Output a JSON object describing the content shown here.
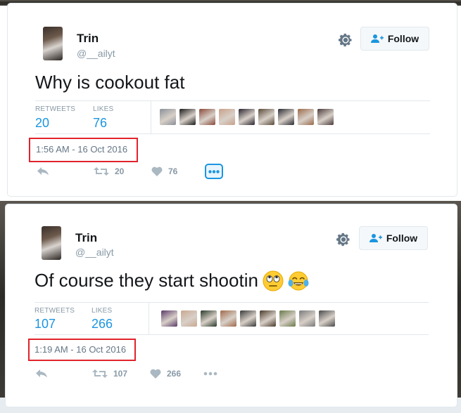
{
  "tweets": [
    {
      "author_name": "Trin",
      "author_handle": "@__ailyt",
      "follow_label": "Follow",
      "text": "Why is cookout fat",
      "emojis": [],
      "retweets_label": "RETWEETS",
      "retweets_count": "20",
      "likes_label": "LIKES",
      "likes_count": "76",
      "timestamp": "1:56 AM - 16 Oct 2016",
      "action_retweet_count": "20",
      "action_like_count": "76",
      "liker_colors": [
        "#8a8f99",
        "#1a1a1a",
        "#8a4a3a",
        "#c8a08a",
        "#2a2430",
        "#5a4a3a",
        "#2b2b33",
        "#9a6a4a",
        "#4a3a3a"
      ]
    },
    {
      "author_name": "Trin",
      "author_handle": "@__ailyt",
      "follow_label": "Follow",
      "text": "Of course they start shootin",
      "emojis": [
        "face-with-rolling-eyes-emoji",
        "face-with-tears-of-joy-emoji"
      ],
      "retweets_label": "RETWEETS",
      "retweets_count": "107",
      "likes_label": "LIKES",
      "likes_count": "266",
      "timestamp": "1:19 AM - 16 Oct 2016",
      "action_retweet_count": "107",
      "action_like_count": "266",
      "liker_colors": [
        "#5a3a6a",
        "#c9a890",
        "#2a3a2a",
        "#a06a4a",
        "#3a3a3a",
        "#4a3a2a",
        "#6a7a4a",
        "#7a7a7a",
        "#4a4a4a"
      ]
    }
  ],
  "colors": {
    "accent": "#1b95e0",
    "highlight": "#e0232b",
    "muted": "#8899a6"
  }
}
